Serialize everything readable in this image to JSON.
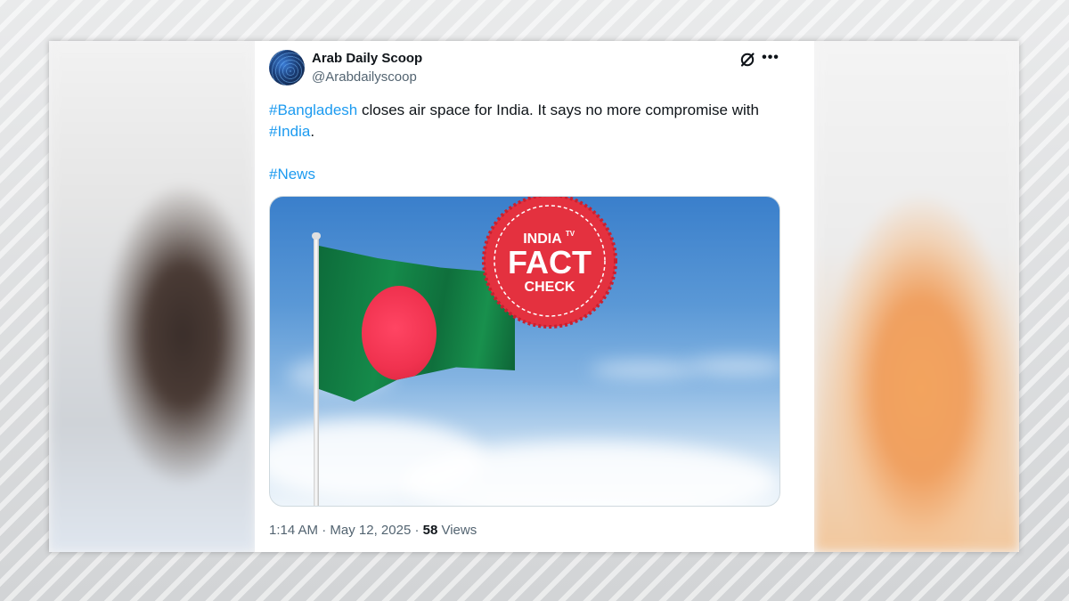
{
  "tweet": {
    "display_name": "Arab Daily Scoop",
    "handle": "@Arabdailyscoop",
    "text_hashtag_1": "#Bangladesh",
    "text_part_1": " closes air space for India.  It says no more compromise with ",
    "text_hashtag_2": "#India",
    "text_part_2": ".",
    "text_hashtag_3": "#News",
    "time": "1:14 AM",
    "separator": " · ",
    "date": "May 12, 2025",
    "views_count": "58",
    "views_label": " Views"
  },
  "badge": {
    "brand_line": "INDIA",
    "brand_tv": "TV",
    "title": "FACT",
    "subtitle": "CHECK"
  },
  "icons": {
    "grok": "grok-icon",
    "more": "more-options-icon"
  },
  "colors": {
    "hashtag": "#1d9bf0",
    "badge_red": "#e4313f",
    "flag_green": "#0f6f3c",
    "flag_red": "#f0324f"
  }
}
